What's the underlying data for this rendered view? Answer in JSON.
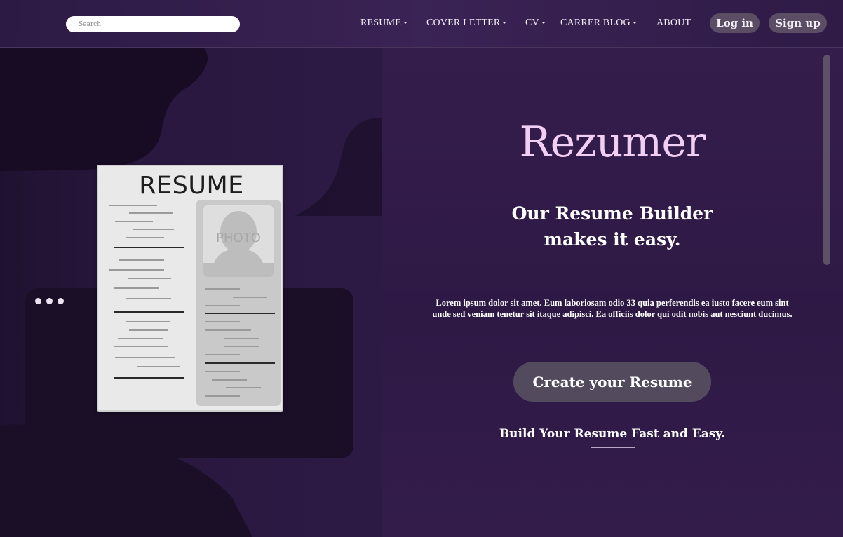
{
  "nav": {
    "search_placeholder": "Search",
    "items": [
      {
        "label": "RESUME",
        "has_caret": true
      },
      {
        "label": "COVER LETTER",
        "has_caret": true
      },
      {
        "label": "CV",
        "has_caret": true
      },
      {
        "label": "CARRER BLOG",
        "has_caret": true
      },
      {
        "label": "ABOUT",
        "has_caret": false
      }
    ],
    "login_label": "Log in",
    "signup_label": "Sign up"
  },
  "illustration": {
    "resume_title": "RESUME",
    "photo_label": "PHOTO"
  },
  "hero": {
    "logo": "Rezumer",
    "headline_line1": "Our Resume Builder",
    "headline_line2": "makes it easy.",
    "body_line1": "Lorem ipsum dolor sit amet. Eum laboriosam odio 33 quia perferendis ea iusto facere eum sint",
    "body_line2": "unde sed veniam tenetur sit itaque adipisci. Ea officiis dolor qui odit nobis aut nesciunt ducimus.",
    "cta_label": "Create your Resume",
    "tagline": "Build Your Resume Fast and Easy."
  },
  "colors": {
    "logo": "#f1cff4",
    "button_bg": "#544a5e",
    "background": "#2e1945"
  }
}
